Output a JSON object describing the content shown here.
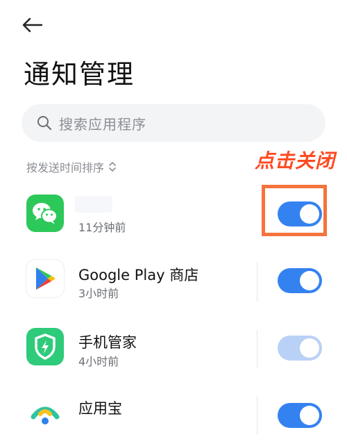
{
  "header": {
    "back_icon": "back-arrow-icon",
    "title": "通知管理"
  },
  "search": {
    "placeholder": "搜索应用程序",
    "icon": "search-icon"
  },
  "sort": {
    "label": "按发送时间排序",
    "icon": "sort-chevrons-icon"
  },
  "annotation": {
    "text": "点击关闭",
    "color": "#ff4a21",
    "box_color": "#f5733c"
  },
  "apps": [
    {
      "name": "",
      "time": "11分钟前",
      "icon": "wechat-icon",
      "enabled": true
    },
    {
      "name": "Google Play 商店",
      "time": "3小时前",
      "icon": "google-play-icon",
      "enabled": true
    },
    {
      "name": "手机管家",
      "time": "4小时前",
      "icon": "phone-manager-shield-icon",
      "enabled": true,
      "dimmed": true
    },
    {
      "name": "应用宝",
      "time": "",
      "icon": "yingyongbao-icon",
      "enabled": true
    }
  ],
  "colors": {
    "toggle_on": "#3482f0",
    "toggle_dimmed": "#b9d1f6",
    "wechat_green": "#2dc85a"
  }
}
